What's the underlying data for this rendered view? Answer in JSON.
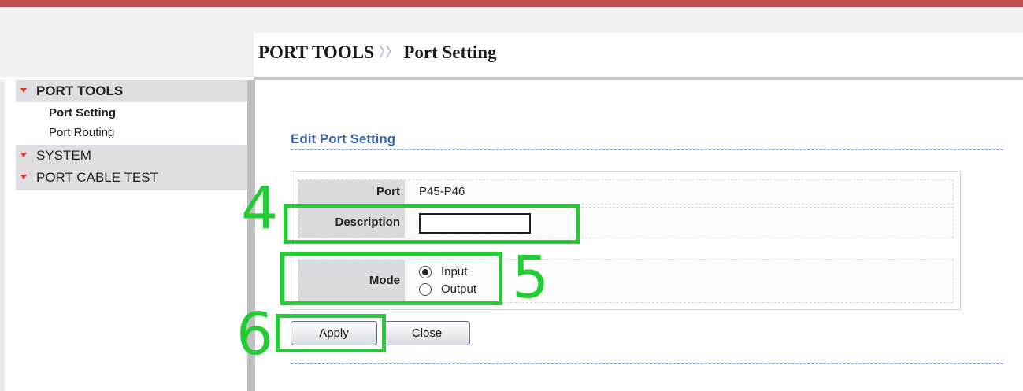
{
  "breadcrumb": {
    "section": "PORT TOOLS",
    "separator": "〉〉",
    "page": "Port Setting"
  },
  "sidebar": {
    "groups": [
      {
        "label": "PORT TOOLS",
        "items": [
          {
            "label": "Port Setting",
            "active": true
          },
          {
            "label": "Port Routing",
            "active": false
          }
        ]
      },
      {
        "label": "SYSTEM",
        "items": []
      },
      {
        "label": "PORT CABLE TEST",
        "items": []
      }
    ]
  },
  "main": {
    "section_title": "Edit Port Setting",
    "form": {
      "port_label": "Port",
      "port_value": "P45-P46",
      "description_label": "Description",
      "description_value": "",
      "mode_label": "Mode",
      "mode_options": [
        {
          "label": "Input",
          "checked": true
        },
        {
          "label": "Output",
          "checked": false
        }
      ]
    },
    "buttons": {
      "apply": "Apply",
      "close": "Close"
    }
  },
  "annotations": {
    "step_description": "4",
    "step_mode": "5",
    "step_apply": "6"
  },
  "colors": {
    "top_accent": "#c0504d",
    "section_title": "#3b64a8",
    "annotation": "#22cc33",
    "menu_arrow": "#d23b2a"
  }
}
